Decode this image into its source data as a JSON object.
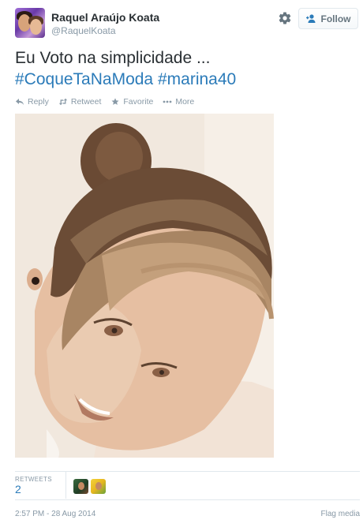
{
  "user": {
    "name": "Raquel Araújo Koata",
    "handle": "@RaquelKoata"
  },
  "follow_label": "Follow",
  "tweet": {
    "line1": "Eu Voto na simplicidade ...",
    "hashtag1": "#CoqueTaNaModa",
    "hashtag2": "#marina40"
  },
  "actions": {
    "reply": "Reply",
    "retweet": "Retweet",
    "favorite": "Favorite",
    "more": "More"
  },
  "stats": {
    "retweets_label": "RETWEETS",
    "retweets_count": "2"
  },
  "timestamp": "2:57 PM - 28 Aug 2014",
  "flag_media": "Flag media",
  "colors": {
    "link": "#2b7bb9",
    "muted": "#8899a6",
    "text": "#292f33"
  },
  "icons": [
    "gear-icon",
    "add-user-icon",
    "reply-icon",
    "retweet-icon",
    "favorite-icon",
    "more-icon"
  ]
}
